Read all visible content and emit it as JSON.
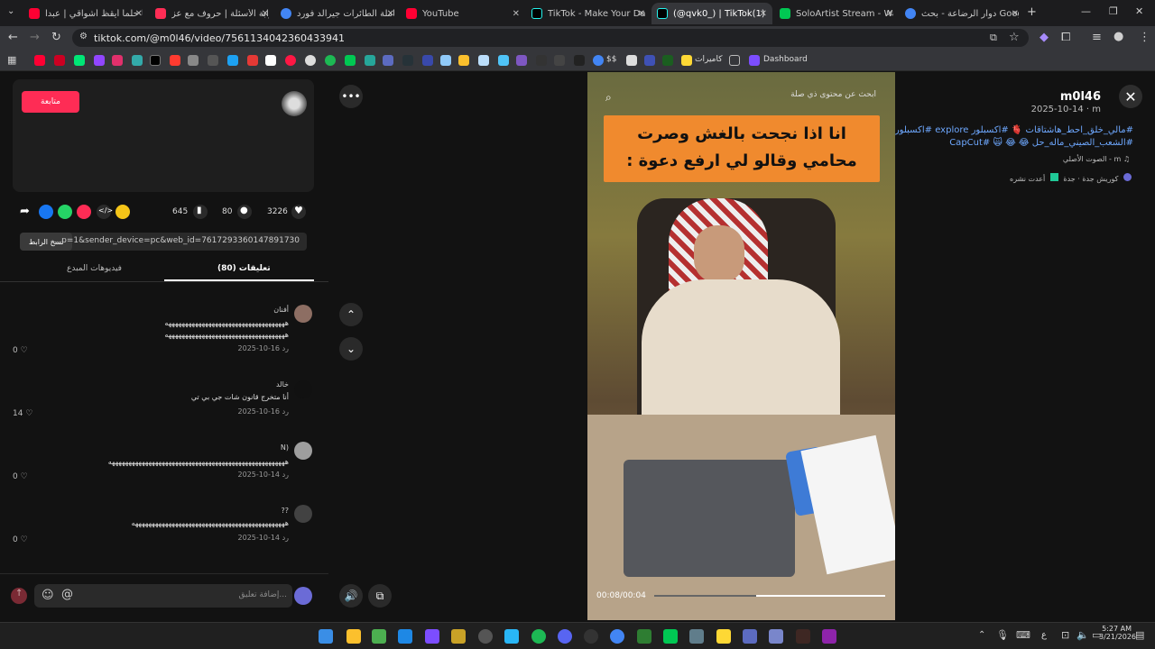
{
  "browser": {
    "tabs": [
      {
        "label": "يا حلماً أيقظ أشواقي | عبدا",
        "color": "#ff0033"
      },
      {
        "label": "بوابة الأسئلة | حروف مع عز",
        "color": "#ff2d55"
      },
      {
        "label": "حاملة الطائرات جيرالد فورد-",
        "color": "#4285f4"
      },
      {
        "label": "YouTube",
        "color": "#ff0033"
      },
      {
        "label": "TikTok - Make Your Day",
        "color": "#111111"
      },
      {
        "label": "(@qvk0_) | TikTok(1)",
        "color": "#111111"
      },
      {
        "label": "SoloArtist Stream - Watch",
        "color": "#00c853"
      },
      {
        "label": "دوار الرضاعة - بحث Google",
        "color": "#4285f4"
      }
    ],
    "url": "tiktok.com/@m0l46/video/7561134042360433941",
    "bookmarks": {
      "folder1": "كاميرات",
      "folder2": "Dashboard",
      "dollar": "$$"
    }
  },
  "post": {
    "follow_label": "متابعة",
    "username": "m0l46",
    "date": "2025-10-14 · m",
    "hashtags_line1": "#مالي_خلق_احط_هاشتاقات 🫀 #اكسبلور explore #اكسبلورررررر",
    "hashtags_line2": "#الشعب_الصيني_ماله_حل 😂 😂 🙀 #CapCut",
    "sound": "الصوت الأصلي - m",
    "repost_info": "أعدت نشره",
    "location": "كوريش جدة · جدة",
    "likes": "3226",
    "comments": "80",
    "saves": "645",
    "copy_link_label": "نسخ الرابط",
    "link_text": "...p=1&sender_device=pc&web_id=7617293360147891730"
  },
  "panel_tabs": {
    "comments": "تعليقات (80)",
    "creator_videos": "فيديوهات المبدع"
  },
  "comments": [
    {
      "author": "أفنان",
      "text": "ههههههههههههههههههههههههههههههههههههه",
      "text2": "ههههههههههههههههههههههههههههههههههههه",
      "date": "2025-10-16",
      "reply": "رد",
      "likes": "0"
    },
    {
      "author": "خالد",
      "text": "أنا متخرج قانون شات جي بي تي",
      "date": "2025-10-16",
      "reply": "رد",
      "likes": "14"
    },
    {
      "author": "N)",
      "text": "هههههههههههههههههههههههههههههههههههههههههههههههههههههه",
      "date": "2025-10-14",
      "reply": "رد",
      "likes": "0"
    },
    {
      "author": "??",
      "text": "ههههههههههههههههههههههههههههههههههههههههههههههه",
      "date": "2025-10-14",
      "reply": "رد",
      "likes": "0"
    }
  ],
  "comment_input": {
    "placeholder": "إضافة تعليق..."
  },
  "video": {
    "search_text": "ابحث عن محتوى ذي صلة",
    "caption_line1": "انا اذا نجحت بالغش وصرت",
    "caption_line2": "محامي وقالو لي ارفع دعوة :",
    "time": "00:08/00:04",
    "progress": 0.56
  },
  "taskbar": {
    "time": "5:27 AM",
    "date": "3/21/2026",
    "lang": "ع"
  }
}
